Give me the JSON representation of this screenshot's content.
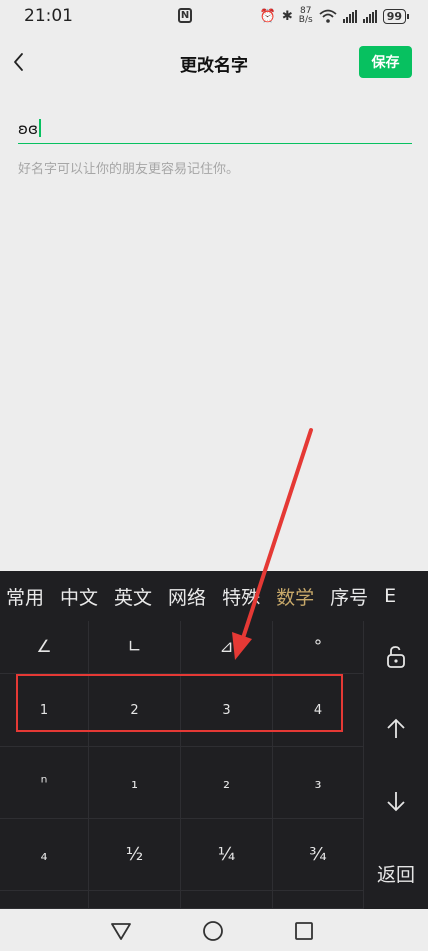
{
  "status_bar": {
    "time": "21:01",
    "nfc": "N",
    "speed_value": "87",
    "speed_unit": "B/s",
    "battery": "99"
  },
  "header": {
    "title": "更改名字",
    "save_label": "保存"
  },
  "name_field": {
    "value": "ʚɞ",
    "hint": "好名字可以让你的朋友更容易记住你。"
  },
  "keyboard": {
    "tabs": [
      "常用",
      "中文",
      "英文",
      "网络",
      "特殊",
      "数学",
      "序号",
      "E"
    ],
    "active_tab": "数学",
    "rows": [
      [
        "∠",
        "∟",
        "⊿",
        "°"
      ],
      [
        "1",
        "2",
        "3",
        "4"
      ],
      [
        "ⁿ",
        "₁",
        "₂",
        "₃"
      ],
      [
        "₄",
        "½",
        "¼",
        "¾"
      ]
    ],
    "side_keys": {
      "lock": "lock-icon",
      "up": "arrow-up-icon",
      "down": "arrow-down-icon",
      "back_label": "返回"
    }
  },
  "annotation": {
    "color": "#e53935"
  },
  "colors": {
    "accent": "#07c160",
    "keyboard_bg": "#1f1f22",
    "active_tab": "#c8a96a"
  }
}
